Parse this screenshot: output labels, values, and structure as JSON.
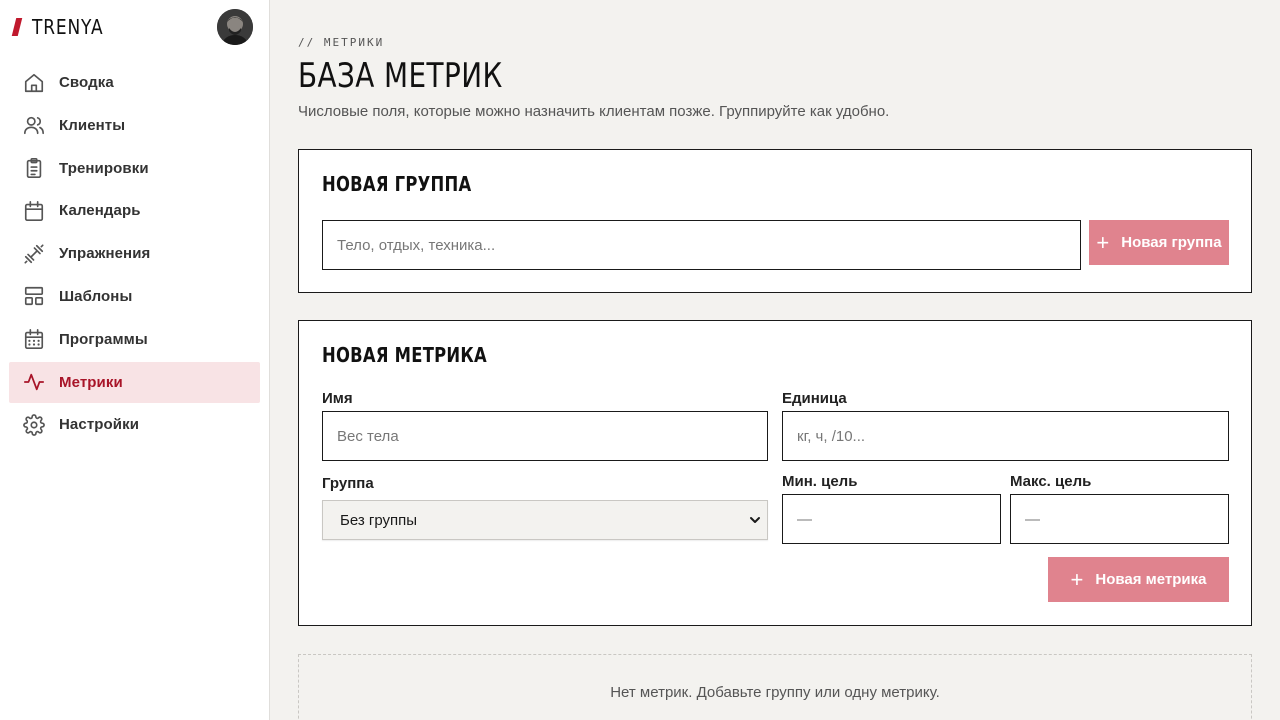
{
  "brand": {
    "name": "TRENYA",
    "accent": "#c0192d"
  },
  "sidebar": {
    "items": [
      {
        "label": "Сводка",
        "icon": "home-icon"
      },
      {
        "label": "Клиенты",
        "icon": "users-icon"
      },
      {
        "label": "Тренировки",
        "icon": "clipboard-icon"
      },
      {
        "label": "Календарь",
        "icon": "calendar-icon"
      },
      {
        "label": "Упражнения",
        "icon": "dumbbell-icon"
      },
      {
        "label": "Шаблоны",
        "icon": "layout-icon"
      },
      {
        "label": "Программы",
        "icon": "calendar-grid-icon"
      },
      {
        "label": "Метрики",
        "icon": "activity-icon",
        "active": true
      },
      {
        "label": "Настройки",
        "icon": "gear-icon"
      }
    ]
  },
  "header": {
    "crumb": "// МЕТРИКИ",
    "title": "БАЗА МЕТРИК",
    "subtitle": "Числовые поля, которые можно назначить клиентам позже. Группируйте как удобно."
  },
  "group_card": {
    "title": "НОВАЯ ГРУППА",
    "input_placeholder": "Тело, отдых, техника...",
    "button_label": "Новая группа"
  },
  "metric_card": {
    "title": "НОВАЯ МЕТРИКА",
    "name_label": "Имя",
    "name_placeholder": "Вес тела",
    "unit_label": "Единица",
    "unit_placeholder": "кг, ч, /10...",
    "group_label": "Группа",
    "group_selected": "Без группы",
    "min_label": "Мин. цель",
    "min_placeholder": "—",
    "max_label": "Макс. цель",
    "max_placeholder": "—",
    "button_label": "Новая метрика"
  },
  "empty_state": "Нет метрик. Добавьте группу или одну метрику.",
  "colors": {
    "active_bg": "#f8e3e5",
    "active_text": "#a81428",
    "button": "#e0838e",
    "page_bg": "#f3f2ef"
  }
}
